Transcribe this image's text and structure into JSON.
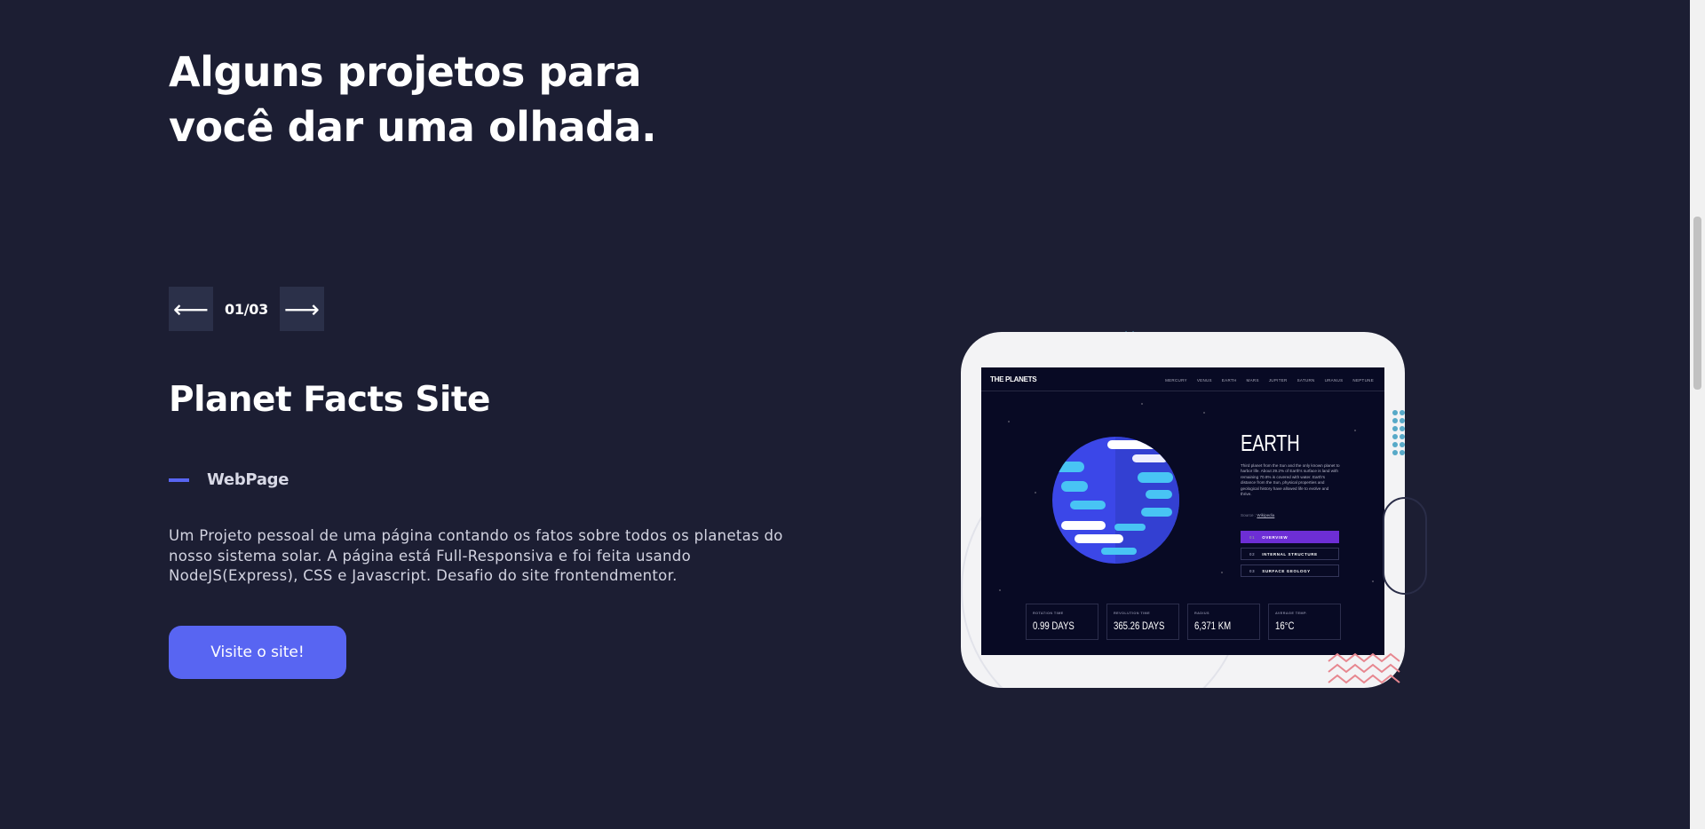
{
  "heading": "Alguns projetos para você dar uma olhada.",
  "pager": {
    "prev_glyph": "⟵",
    "next_glyph": "⟶",
    "counter": "01/03"
  },
  "project": {
    "title": "Planet Facts Site",
    "tag": "WebPage",
    "description": "Um Projeto pessoal de uma página contando os fatos sobre todos os planetas do nosso sistema solar. A página está Full-Responsiva e foi feita usando NodeJS(Express), CSS e Javascript. Desafio do site frontendmentor.",
    "visit_label": "Visite o site!"
  },
  "preview": {
    "brand": "THE PLANETS",
    "nav": [
      "MERCURY",
      "VENUS",
      "EARTH",
      "MARS",
      "JUPITER",
      "SATURN",
      "URANUS",
      "NEPTUNE"
    ],
    "planet_name": "EARTH",
    "planet_text": "Third planet from the Sun and the only known planet to harbor life. About 29.2% of Earth's surface is land with remaining 70.8% is covered with water. Earth's distance from the Sun, physical properties and geological history have allowed life to evolve and thrive.",
    "source_label": "Source :",
    "source_link": "Wikipedia",
    "tabs": [
      {
        "num": "01",
        "label": "OVERVIEW"
      },
      {
        "num": "02",
        "label": "INTERNAL STRUCTURE"
      },
      {
        "num": "03",
        "label": "SURFACE GEOLOGY"
      }
    ],
    "stats": [
      {
        "label": "ROTATION TIME",
        "value": "0.99 DAYS"
      },
      {
        "label": "REVOLUTION TIME",
        "value": "365.26 DAYS"
      },
      {
        "label": "RADIUS",
        "value": "6,371 KM"
      },
      {
        "label": "AVERAGE TEMP.",
        "value": "16°C"
      }
    ]
  },
  "colors": {
    "background": "#1c1e33",
    "accent": "#5865f2",
    "pager_button": "#2b3049",
    "active_tab": "#6d2ed5"
  }
}
